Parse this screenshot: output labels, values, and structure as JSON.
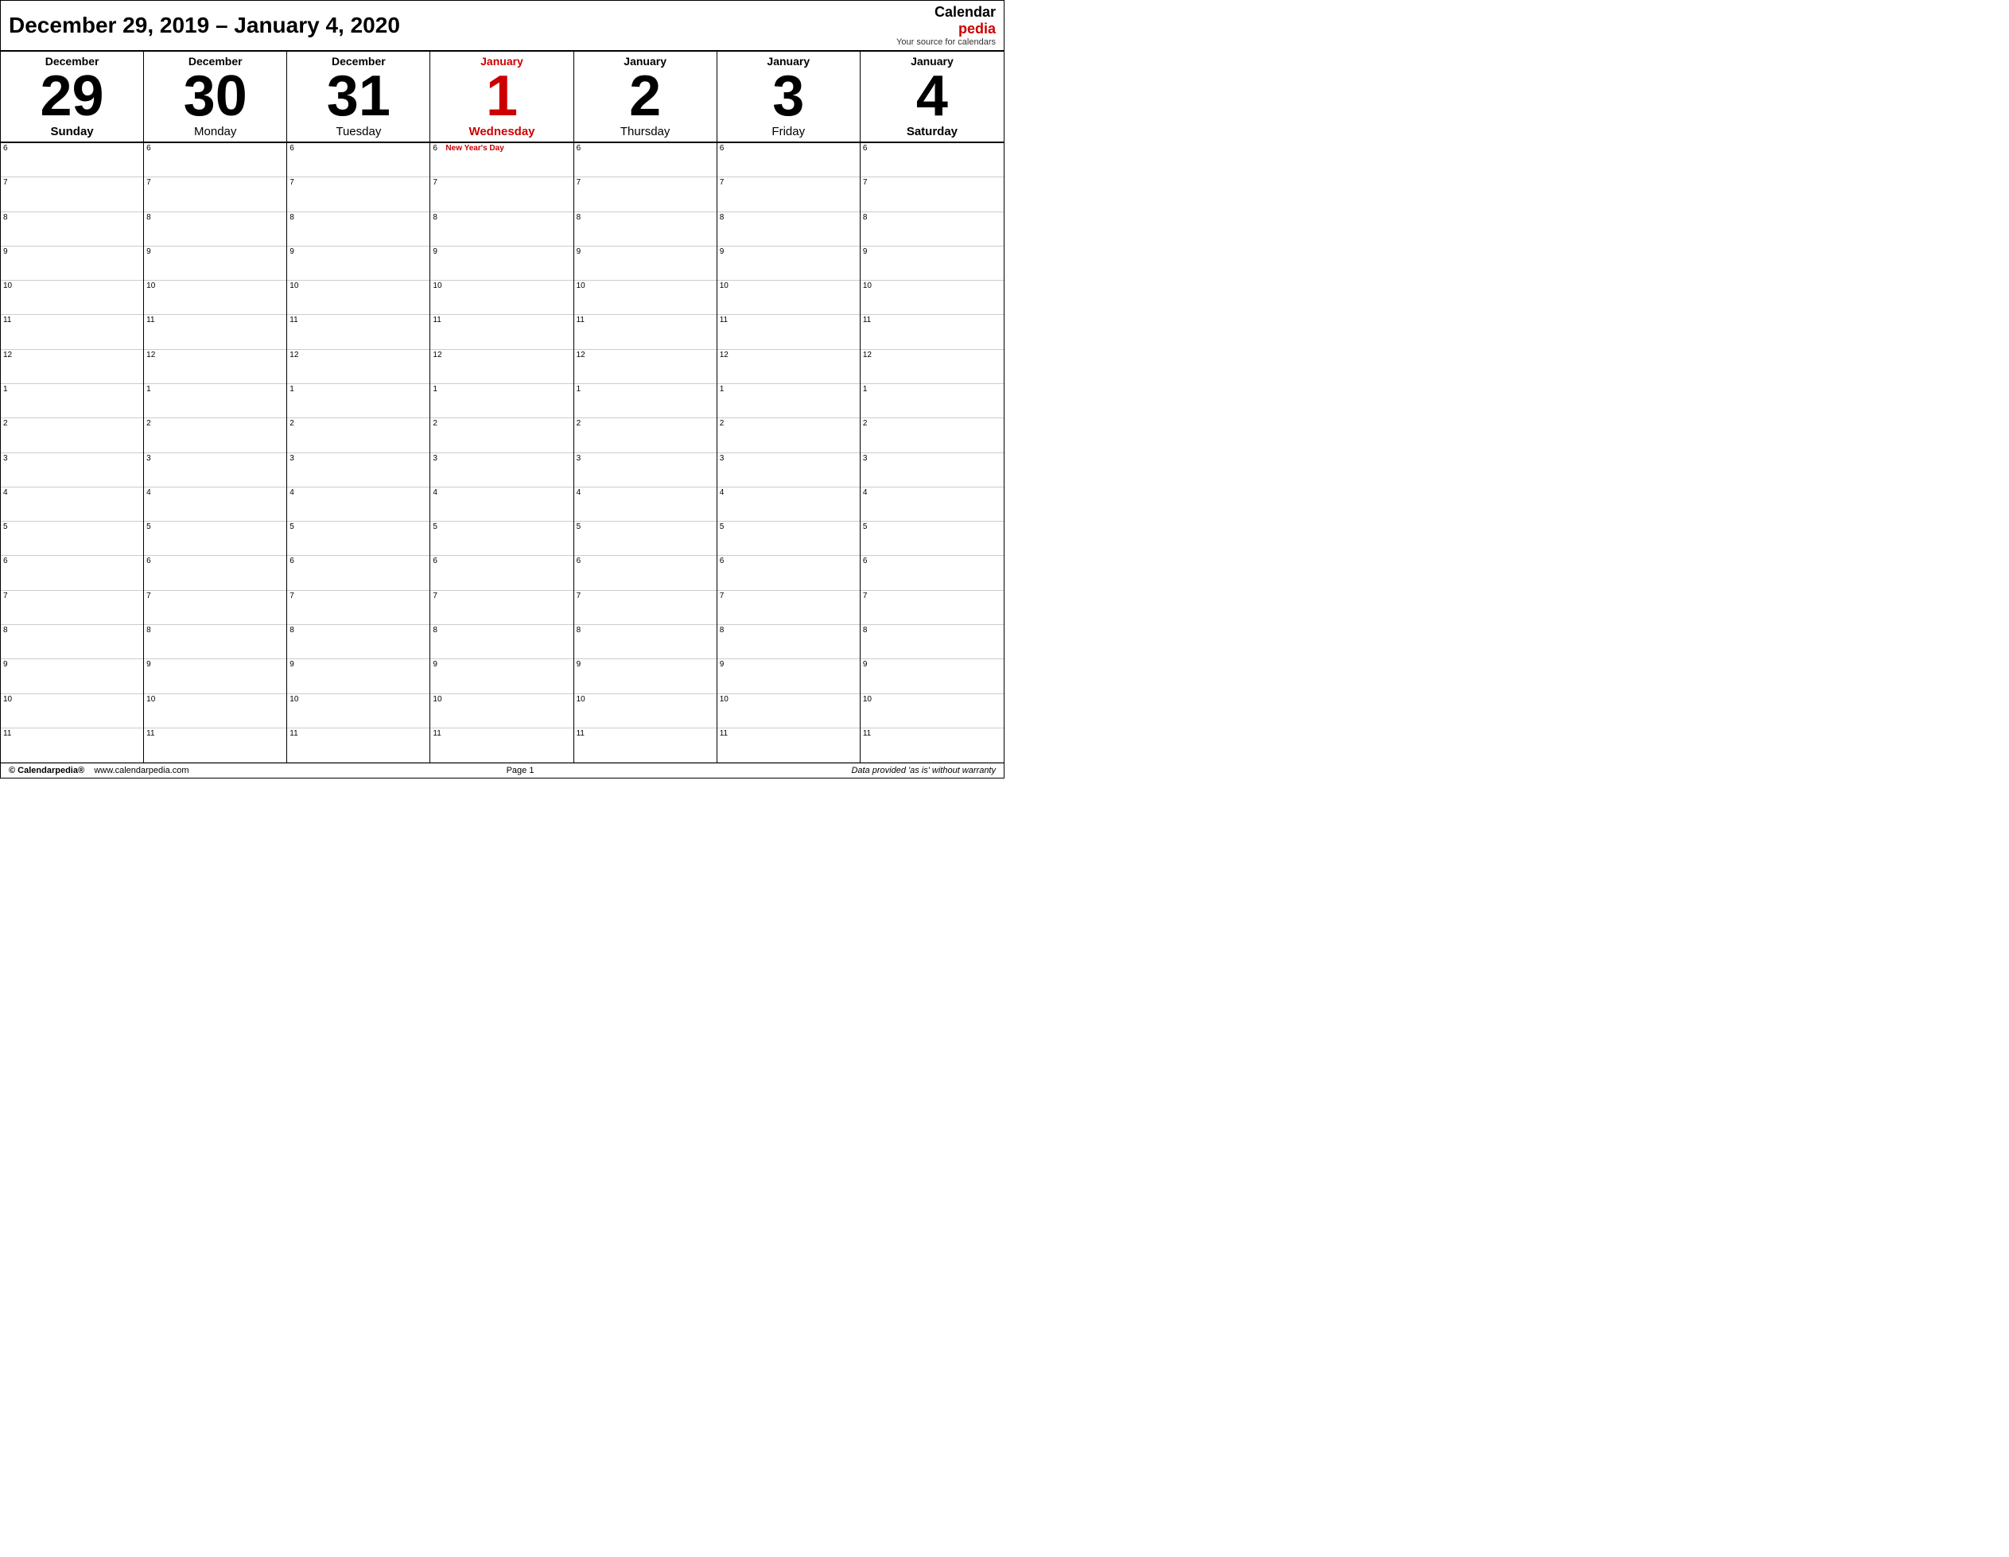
{
  "header": {
    "title_prefix": "December 29, 2019 - January 4, 2020",
    "title_dec": "December 29, 2019 - ",
    "title_jan": "January 4, 2020",
    "logo_calendar": "Calendar",
    "logo_pedia": "pedia",
    "logo_tagline": "Your source for calendars"
  },
  "days": [
    {
      "month": "December",
      "month_red": false,
      "num": "29",
      "num_red": false,
      "name": "Sunday",
      "name_bold": true,
      "name_red": false
    },
    {
      "month": "December",
      "month_red": false,
      "num": "30",
      "num_red": false,
      "name": "Monday",
      "name_bold": false,
      "name_red": false
    },
    {
      "month": "December",
      "month_red": false,
      "num": "31",
      "num_red": false,
      "name": "Tuesday",
      "name_bold": false,
      "name_red": false
    },
    {
      "month": "January",
      "month_red": true,
      "num": "1",
      "num_red": true,
      "name": "Wednesday",
      "name_bold": true,
      "name_red": true
    },
    {
      "month": "January",
      "month_red": false,
      "num": "2",
      "num_red": false,
      "name": "Thursday",
      "name_bold": false,
      "name_red": false
    },
    {
      "month": "January",
      "month_red": false,
      "num": "3",
      "num_red": false,
      "name": "Friday",
      "name_bold": false,
      "name_red": false
    },
    {
      "month": "January",
      "month_red": false,
      "num": "4",
      "num_red": false,
      "name": "Saturday",
      "name_bold": true,
      "name_red": false
    }
  ],
  "time_slots": [
    {
      "label": "6"
    },
    {
      "label": "7"
    },
    {
      "label": "8"
    },
    {
      "label": "9"
    },
    {
      "label": "10"
    },
    {
      "label": "11"
    },
    {
      "label": "12"
    },
    {
      "label": "1"
    },
    {
      "label": "2"
    },
    {
      "label": "3"
    },
    {
      "label": "4"
    },
    {
      "label": "5"
    },
    {
      "label": "6"
    },
    {
      "label": "7"
    },
    {
      "label": "8"
    },
    {
      "label": "9"
    },
    {
      "label": "10"
    },
    {
      "label": "11"
    }
  ],
  "holiday": {
    "day_index": 3,
    "slot_index": 0,
    "label": "New Year's Day"
  },
  "footer": {
    "copyright": "© Calendarpedia®",
    "website": "www.calendarpedia.com",
    "page": "Page 1",
    "disclaimer": "Data provided 'as is' without warranty"
  }
}
